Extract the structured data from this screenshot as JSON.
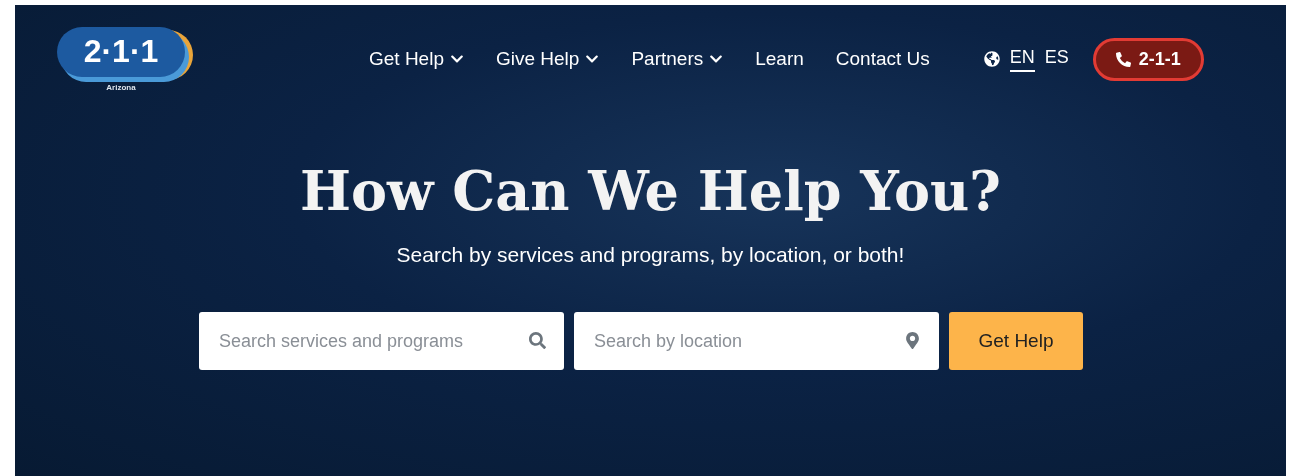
{
  "logo": {
    "number": "2·1·1",
    "region": "Arizona"
  },
  "nav": [
    {
      "label": "Get Help",
      "kind": "dropdown"
    },
    {
      "label": "Give Help",
      "kind": "dropdown"
    },
    {
      "label": "Partners",
      "kind": "dropdown"
    },
    {
      "label": "Learn",
      "kind": "link"
    },
    {
      "label": "Contact Us",
      "kind": "link"
    }
  ],
  "languages": [
    {
      "label": "EN",
      "selected": true
    },
    {
      "label": "ES",
      "selected": false
    }
  ],
  "call_button": "2-1-1",
  "hero": {
    "title": "How Can We Help You?",
    "subtitle": "Search by services and programs, by location, or both!"
  },
  "search": {
    "services_placeholder": "Search services and programs",
    "location_placeholder": "Search by location",
    "button": "Get Help"
  }
}
